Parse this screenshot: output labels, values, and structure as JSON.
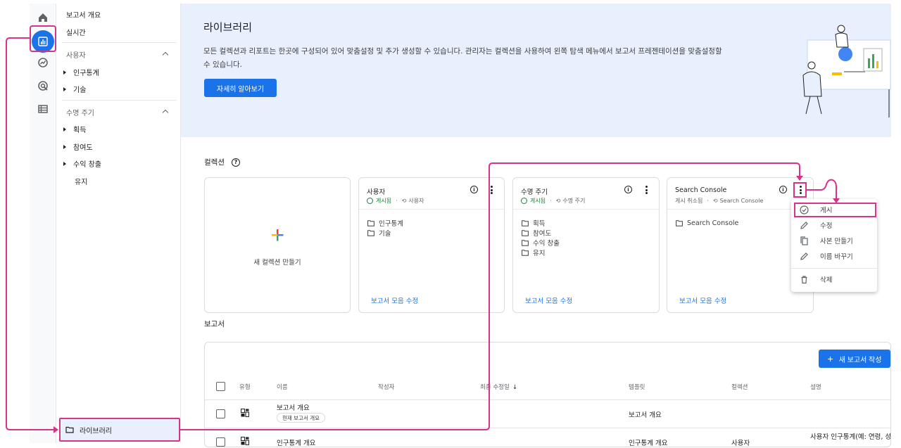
{
  "nav": {
    "reports_snapshot": "보고서 개요",
    "realtime": "실시간",
    "user_section": "사용자",
    "user_items": [
      "인구통계",
      "기술"
    ],
    "lifecycle_section": "수명 주기",
    "lifecycle_items": [
      "획득",
      "참여도",
      "수익 창출"
    ],
    "retention": "유지",
    "library": "라이브러리"
  },
  "banner": {
    "title": "라이브러리",
    "description": "모든 컬렉션과 리포트는 한곳에 구성되어 있어 맞춤설정 및 추가 생성할 수 있습니다. 관리자는 컬렉션을 사용하여 왼쪽 탐색 메뉴에서 보고서 프레젠테이션을 맞춤설정할 수 있습니다.",
    "learn_more": "자세히 알아보기"
  },
  "collections": {
    "label": "컬렉션",
    "new_collection": "새 컬렉션 만들기",
    "edit_label": "보고서 모음 수정",
    "cards": [
      {
        "title": "사용자",
        "status": "게시됨",
        "template": "사용자",
        "items": [
          "인구통계",
          "기술"
        ]
      },
      {
        "title": "수명 주기",
        "status": "게시됨",
        "template": "수명 주기",
        "items": [
          "획득",
          "참여도",
          "수익 창출",
          "유지"
        ]
      },
      {
        "title": "Search Console",
        "status": "게시 취소됨",
        "template": "Search Console",
        "items": [
          "Search Console"
        ]
      }
    ]
  },
  "menu": {
    "items": [
      "게시",
      "수정",
      "사본 만들기",
      "이름 바꾸기",
      "삭제"
    ]
  },
  "reports": {
    "label": "보고서",
    "new_report": "새 보고서 작성",
    "columns": [
      "유형",
      "이름",
      "작성자",
      "최종 수정일",
      "템플릿",
      "컬렉션",
      "설명"
    ],
    "rows": [
      {
        "name": "보고서 개요",
        "chip": "현재 보고서 개요",
        "template": "보고서 개요",
        "collection": "",
        "description": ""
      },
      {
        "name": "인구통계 개요",
        "chip": "",
        "template": "인구통계 개요",
        "collection": "사용자",
        "description": "사용자 인구통계(예: 연령, 성"
      }
    ]
  },
  "colors": {
    "accent": "#1a73e8",
    "annotation": "#d6338a",
    "banner_bg": "#e8f0fe",
    "published": "#188038"
  }
}
